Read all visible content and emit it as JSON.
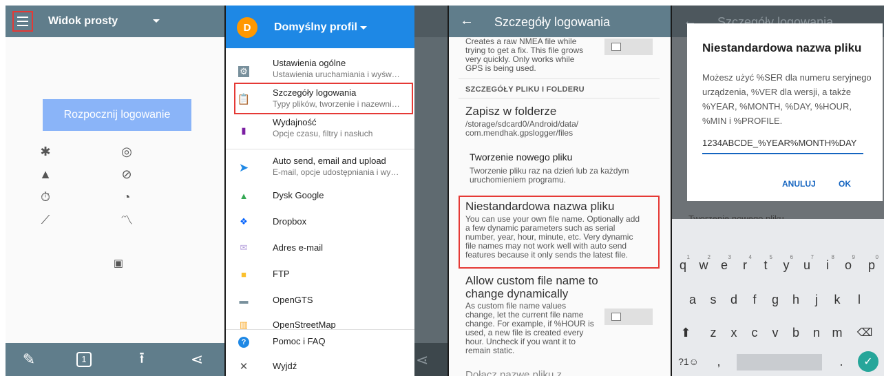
{
  "panel1": {
    "title": "Widok prosty",
    "start_button": "Rozpocznij logowanie",
    "icons": [
      "satellite-icon",
      "location-icon",
      "mountain-icon",
      "compass-icon",
      "timer-icon",
      "speedometer-icon",
      "ruler-icon",
      "route-icon",
      "log-file-icon"
    ],
    "bottom": {
      "page_number": "1"
    }
  },
  "panel2": {
    "avatar_letter": "D",
    "profile": "Domyślny profil",
    "items": [
      {
        "title": "Ustawienia ogólne",
        "subtitle": "Ustawienia uruchamiania i wyśw…",
        "icon": "gear-icon"
      },
      {
        "title": "Szczegóły logowania",
        "subtitle": "Typy plików, tworzenie i nazewni…",
        "icon": "clipboard-icon"
      },
      {
        "title": "Wydajność",
        "subtitle": "Opcje czasu, filtry i nasłuch",
        "icon": "bar-chart-icon"
      },
      {
        "title": "Auto send, email and upload",
        "subtitle": "E-mail, opcje udostępniania i wy…",
        "icon": "send-icon"
      },
      {
        "title": "Dysk Google",
        "icon": "drive-icon"
      },
      {
        "title": "Dropbox",
        "icon": "dropbox-icon"
      },
      {
        "title": "Adres e-mail",
        "icon": "email-icon"
      },
      {
        "title": "FTP",
        "icon": "folder-icon"
      },
      {
        "title": "OpenGTS",
        "icon": "truck-icon"
      },
      {
        "title": "OpenStreetMap",
        "icon": "map-icon"
      },
      {
        "title": "Pomoc i FAQ",
        "icon": "help-icon"
      },
      {
        "title": "Wyjdź",
        "icon": "close-icon"
      }
    ]
  },
  "panel3": {
    "title": "Szczegóły logowania",
    "top_text": [
      "Creates a raw NMEA file while",
      "trying to get a fix. This file grows",
      "very quickly. Only works while",
      "GPS is being used."
    ],
    "section_header": "SZCZEGÓŁY PLIKU I FOLDERU",
    "save_folder": {
      "title": "Zapisz w folderze",
      "path": [
        "/storage/sdcard0/Android/data/",
        "com.mendhak.gpslogger/files"
      ]
    },
    "new_file": {
      "title": "Tworzenie nowego pliku",
      "desc": [
        "Tworzenie pliku raz na dzień lub za każdym",
        "uruchomieniem programu."
      ]
    },
    "custom_name": {
      "title": "Niestandardowa nazwa pliku",
      "desc": [
        "You can use your own file name. Optionally add",
        "a few dynamic parameters such as serial",
        "number, year, hour, minute, etc. Very dynamic",
        "file names may not work well with auto send",
        "features because it only sends the latest file."
      ]
    },
    "dynamic": {
      "title": [
        "Allow custom file name to",
        "change dynamically"
      ],
      "desc": [
        "As custom file name values",
        "change, let the current file name",
        "change. For example, if %HOUR is",
        "used, a new file is created every",
        "hour. Uncheck if you want it to",
        "remain static."
      ]
    },
    "cut_off": "Dołącz nazwę pliku z..."
  },
  "panel4": {
    "title": "Szczegóły logowania",
    "dialog": {
      "title": "Niestandardowa nazwa pliku",
      "message": "Możesz użyć %SER dla numeru seryjnego urządzenia, %VER dla wersji, a także %YEAR, %MONTH, %DAY, %HOUR, %MIN i %PROFILE.",
      "input_value": "1234ABCDE_%YEAR%MONTH%DAY",
      "cancel": "ANULUJ",
      "ok": "OK"
    },
    "behind_text": "Tworzenie nowego pliku",
    "keyboard": {
      "row1": [
        {
          "k": "q",
          "n": "1"
        },
        {
          "k": "w",
          "n": "2"
        },
        {
          "k": "e",
          "n": "3"
        },
        {
          "k": "r",
          "n": "4"
        },
        {
          "k": "t",
          "n": "5"
        },
        {
          "k": "y",
          "n": "6"
        },
        {
          "k": "u",
          "n": "7"
        },
        {
          "k": "i",
          "n": "8"
        },
        {
          "k": "o",
          "n": "9"
        },
        {
          "k": "p",
          "n": "0"
        }
      ],
      "row2": [
        "a",
        "s",
        "d",
        "f",
        "g",
        "h",
        "j",
        "k",
        "l"
      ],
      "row3": [
        "z",
        "x",
        "c",
        "v",
        "b",
        "n",
        "m"
      ],
      "symbols": "?1☺",
      "comma": ",",
      "period": "."
    }
  }
}
